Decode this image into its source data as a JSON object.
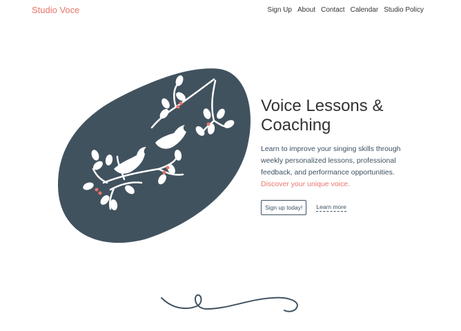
{
  "brand": {
    "name": "Studio Voce"
  },
  "nav": {
    "items": [
      {
        "label": "Sign Up"
      },
      {
        "label": "About"
      },
      {
        "label": "Contact"
      },
      {
        "label": "Calendar"
      },
      {
        "label": "Studio Policy"
      }
    ]
  },
  "hero": {
    "title_line1": "Voice Lessons &",
    "title_line2": "Coaching",
    "description": "Learn to improve your singing skills through weekly personalized lessons, professional feedback, and performance opportunities.",
    "accent_text": "Discover your unique voice.",
    "primary_button": "Sign up today!",
    "secondary_link": "Learn more",
    "illustration": "birds-on-branch-illustration"
  },
  "colors": {
    "accent": "#e8756b",
    "slate": "#41525f",
    "text": "#333333"
  },
  "decor": {
    "divider": "flourish-divider"
  }
}
